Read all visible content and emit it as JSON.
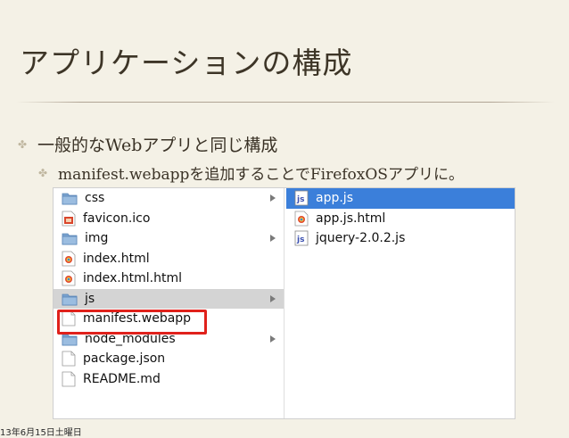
{
  "slide": {
    "title": "アプリケーションの構成",
    "bullets": [
      {
        "text": "一般的なWebアプリと同じ構成"
      },
      {
        "text": "manifest.webappを追加することでFirefoxOSアプリに。"
      }
    ],
    "footer_date": "13年6月15日土曜日"
  },
  "finder": {
    "left_column": [
      {
        "name": "css",
        "icon": "folder-icon",
        "has_children": true,
        "state": "normal"
      },
      {
        "name": "favicon.ico",
        "icon": "ico-file-icon",
        "has_children": false,
        "state": "normal"
      },
      {
        "name": "img",
        "icon": "folder-icon",
        "has_children": true,
        "state": "normal"
      },
      {
        "name": "index.html",
        "icon": "html-file-icon",
        "has_children": false,
        "state": "normal"
      },
      {
        "name": "index.html.html",
        "icon": "html-file-icon",
        "has_children": false,
        "state": "normal"
      },
      {
        "name": "js",
        "icon": "folder-icon",
        "has_children": true,
        "state": "selected-inactive"
      },
      {
        "name": "manifest.webapp",
        "icon": "blank-file-icon",
        "has_children": false,
        "state": "highlighted"
      },
      {
        "name": "node_modules",
        "icon": "folder-icon",
        "has_children": true,
        "state": "normal"
      },
      {
        "name": "package.json",
        "icon": "blank-file-icon",
        "has_children": false,
        "state": "normal"
      },
      {
        "name": "README.md",
        "icon": "blank-file-icon",
        "has_children": false,
        "state": "normal"
      }
    ],
    "right_column": [
      {
        "name": "app.js",
        "icon": "js-file-icon",
        "state": "selected"
      },
      {
        "name": "app.js.html",
        "icon": "html-file-icon",
        "state": "normal"
      },
      {
        "name": "jquery-2.0.2.js",
        "icon": "js-file-icon",
        "state": "normal"
      }
    ],
    "highlight_color": "#e0211b",
    "selection_color": "#3b7fda",
    "folder_color": "#7aa3cf"
  }
}
